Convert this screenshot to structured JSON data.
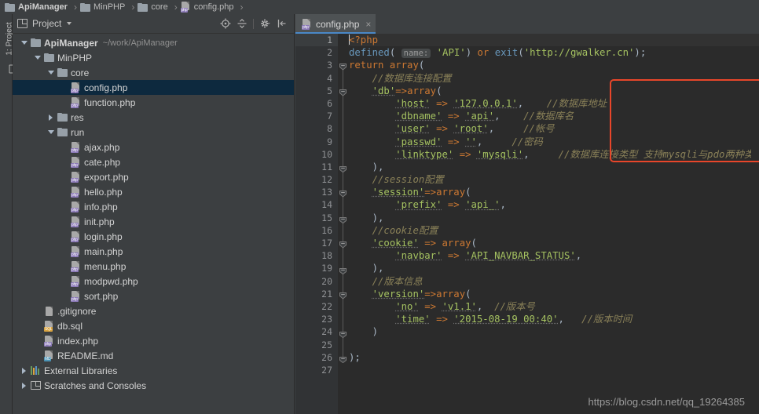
{
  "breadcrumb": [
    {
      "label": "ApiManager",
      "icon": "folder-icon",
      "bold": true
    },
    {
      "label": "MinPHP",
      "icon": "folder-icon",
      "bold": false
    },
    {
      "label": "core",
      "icon": "folder-icon",
      "bold": false
    },
    {
      "label": "config.php",
      "icon": "php-file-icon",
      "bold": false
    }
  ],
  "tool_window_tab": {
    "label": "1: Project"
  },
  "project_panel": {
    "title": "Project",
    "icons": [
      "project-view-icon",
      "chevron-down-icon",
      "locate-icon",
      "collapse-all-icon",
      "settings-gear-icon",
      "hide-panel-icon"
    ],
    "tree": [
      {
        "label": "ApiManager",
        "path": "~/work/ApiManager",
        "icon": "folder-icon",
        "arrow": "down",
        "indent": 0,
        "bold": true,
        "selected": false
      },
      {
        "label": "MinPHP",
        "path": "",
        "icon": "folder-icon",
        "arrow": "down",
        "indent": 1,
        "bold": false,
        "selected": false
      },
      {
        "label": "core",
        "path": "",
        "icon": "folder-icon",
        "arrow": "down",
        "indent": 2,
        "bold": false,
        "selected": false
      },
      {
        "label": "config.php",
        "path": "",
        "icon": "php-file-icon",
        "arrow": "none",
        "indent": 3,
        "bold": false,
        "selected": true
      },
      {
        "label": "function.php",
        "path": "",
        "icon": "php-file-icon",
        "arrow": "none",
        "indent": 3,
        "bold": false,
        "selected": false
      },
      {
        "label": "res",
        "path": "",
        "icon": "folder-icon",
        "arrow": "right",
        "indent": 2,
        "bold": false,
        "selected": false
      },
      {
        "label": "run",
        "path": "",
        "icon": "folder-icon",
        "arrow": "down",
        "indent": 2,
        "bold": false,
        "selected": false
      },
      {
        "label": "ajax.php",
        "path": "",
        "icon": "php-file-icon",
        "arrow": "none",
        "indent": 3,
        "bold": false,
        "selected": false
      },
      {
        "label": "cate.php",
        "path": "",
        "icon": "php-file-icon",
        "arrow": "none",
        "indent": 3,
        "bold": false,
        "selected": false
      },
      {
        "label": "export.php",
        "path": "",
        "icon": "php-file-icon",
        "arrow": "none",
        "indent": 3,
        "bold": false,
        "selected": false
      },
      {
        "label": "hello.php",
        "path": "",
        "icon": "php-file-icon",
        "arrow": "none",
        "indent": 3,
        "bold": false,
        "selected": false
      },
      {
        "label": "info.php",
        "path": "",
        "icon": "php-file-icon",
        "arrow": "none",
        "indent": 3,
        "bold": false,
        "selected": false
      },
      {
        "label": "init.php",
        "path": "",
        "icon": "php-file-icon",
        "arrow": "none",
        "indent": 3,
        "bold": false,
        "selected": false
      },
      {
        "label": "login.php",
        "path": "",
        "icon": "php-file-icon",
        "arrow": "none",
        "indent": 3,
        "bold": false,
        "selected": false
      },
      {
        "label": "main.php",
        "path": "",
        "icon": "php-file-icon",
        "arrow": "none",
        "indent": 3,
        "bold": false,
        "selected": false
      },
      {
        "label": "menu.php",
        "path": "",
        "icon": "php-file-icon",
        "arrow": "none",
        "indent": 3,
        "bold": false,
        "selected": false
      },
      {
        "label": "modpwd.php",
        "path": "",
        "icon": "php-file-icon",
        "arrow": "none",
        "indent": 3,
        "bold": false,
        "selected": false
      },
      {
        "label": "sort.php",
        "path": "",
        "icon": "php-file-icon",
        "arrow": "none",
        "indent": 3,
        "bold": false,
        "selected": false
      },
      {
        "label": ".gitignore",
        "path": "",
        "icon": "plain-file-icon",
        "arrow": "none",
        "indent": 1,
        "bold": false,
        "selected": false
      },
      {
        "label": "db.sql",
        "path": "",
        "icon": "sql-file-icon",
        "arrow": "none",
        "indent": 1,
        "bold": false,
        "selected": false
      },
      {
        "label": "index.php",
        "path": "",
        "icon": "php-file-icon",
        "arrow": "none",
        "indent": 1,
        "bold": false,
        "selected": false
      },
      {
        "label": "README.md",
        "path": "",
        "icon": "md-file-icon",
        "arrow": "none",
        "indent": 1,
        "bold": false,
        "selected": false
      },
      {
        "label": "External Libraries",
        "path": "",
        "icon": "libraries-icon",
        "arrow": "right",
        "indent": 0,
        "bold": false,
        "selected": false
      },
      {
        "label": "Scratches and Consoles",
        "path": "",
        "icon": "scratches-icon",
        "arrow": "right",
        "indent": 0,
        "bold": false,
        "selected": false
      }
    ]
  },
  "editor": {
    "tab": {
      "label": "config.php",
      "icon": "php-file-icon",
      "close": "×",
      "active": true
    },
    "line_numbers": [
      1,
      2,
      3,
      4,
      5,
      6,
      7,
      8,
      9,
      10,
      11,
      12,
      13,
      14,
      15,
      16,
      17,
      18,
      19,
      20,
      21,
      22,
      23,
      24,
      25,
      26,
      27
    ],
    "current_line": 1,
    "lines": [
      "<?php",
      "defined( name: 'API') or exit('http://gwalker.cn');",
      "return array(",
      "    //数据库连接配置",
      "    'db'=>array(",
      "        'host' => '127.0.0.1',    //数据库地址",
      "        'dbname' => 'api',    //数据库名",
      "        'user' => 'root',     //帐号",
      "        'passwd' => '',     //密码",
      "        'linktype' => 'mysqli',     //数据库连接类型 支持mysqli与pdo两种类型",
      "    ),",
      "    //session配置",
      "    'session'=>array(",
      "        'prefix' => 'api_',",
      "    ),",
      "    //cookie配置",
      "    'cookie' => array(",
      "        'navbar' => 'API_NAVBAR_STATUS',",
      "    ),",
      "    //版本信息",
      "    'version'=>array(",
      "        'no' => 'v1.1',  //版本号",
      "        'time' => '2015-08-19 00:40',   //版本时间",
      "    )",
      "",
      ");",
      ""
    ],
    "fold_lines": [
      3,
      5,
      11,
      13,
      15,
      17,
      19,
      21,
      24,
      26
    ],
    "annotation": {
      "type": "red-rectangle",
      "covers_lines": "5-11",
      "color": "#e8462a"
    }
  },
  "watermark": {
    "text": "https://blog.csdn.net/qq_19264385"
  },
  "colors": {
    "background": "#2b2b2b",
    "panel": "#3c3f41",
    "selection": "#0d293e",
    "keyword": "#cc7832",
    "string": "#a5c261",
    "comment": "#8a8158",
    "function": "#6897bb",
    "accent": "#4a88c7",
    "annotation": "#e8462a"
  }
}
